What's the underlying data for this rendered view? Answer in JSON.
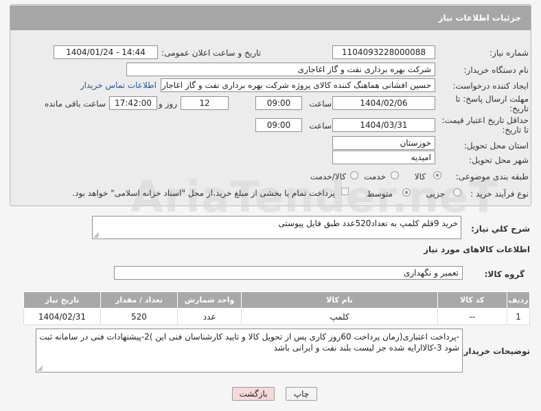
{
  "header": {
    "title": "جزئیات اطلاعات نیاز"
  },
  "fields": {
    "need_number_label": "شماره نیاز:",
    "need_number": "1104093228000088",
    "announce_label": "تاریخ و ساعت اعلان عمومی:",
    "announce_value": "1404/01/24 - 14:44",
    "buyer_org_label": "نام دستگاه خریدار:",
    "buyer_org": "شرکت بهره برداری نفت و گاز اغاجاری",
    "requester_label": "ایجاد کننده درخواست:",
    "requester": "حسین افشانی هماهنگ کننده کالای پروژه شرکت بهره برداری نفت و گاز اغاجاری",
    "contact_link": "اطلاعات تماس خریدار",
    "deadline_label_1": "مهلت ارسال پاسخ: تا",
    "deadline_label_2": "تاریخ:",
    "deadline_date": "1404/02/06",
    "time_label": "ساعت",
    "deadline_time": "09:00",
    "days_value": "12",
    "days_label": "روز و",
    "remaining_time": "17:42:00",
    "remaining_label": "ساعت باقی مانده",
    "validity_label_1": "حداقل تاریخ اعتبار قیمت:",
    "validity_label_2": "تا تاریخ:",
    "validity_date": "1404/03/31",
    "validity_time": "09:00",
    "province_label": "استان محل تحویل:",
    "province": "خوزستان",
    "city_label": "شهر محل تحویل:",
    "city": "امیدیه",
    "category_label": "طبقه بندی موضوعی:",
    "category_options": [
      "کالا",
      "خدمت",
      "کالا/خدمت"
    ],
    "purchase_type_label": "نوع فرآیند خرید :",
    "purchase_options": [
      "جزیی",
      "متوسط"
    ],
    "treasury_note": "پرداخت تمام یا بخشی از مبلغ خرید،از محل \"اسناد خزانه اسلامی\" خواهد بود."
  },
  "description": {
    "label": "شرح کلي نياز:",
    "value": "خرید 9قلم کلمپ به تعداد520عدد طبق فایل پیوستی"
  },
  "goods_info_title": "اطلاعات کالاهای مورد نیاز",
  "goods_group": {
    "label": "گروه کالا:",
    "value": "تعمیر و نگهداری"
  },
  "table": {
    "headers": [
      "ردیف",
      "کد کالا",
      "نام کالا",
      "واحد شمارش",
      "تعداد / مقدار",
      "تاریخ نیاز"
    ],
    "rows": [
      [
        "1",
        "--",
        "کلمپ",
        "عدد",
        "520",
        "1404/02/31"
      ]
    ]
  },
  "buyer_notes": {
    "label": "توضیحات خریدار:",
    "value": "-پرداخت اعتباری(زمان پرداخت 60روز کاری پس از تحویل کالا و تایید کارشناسان فنی این )2-پیشنهادات فنی در سامانه ثبت شود 3-کالاارایه شده جز لیست بلند نفت و ایرانی باشد"
  },
  "buttons": {
    "print": "چاپ",
    "back": "بازگشت"
  },
  "watermark": "AriaTender.neT",
  "colors": {
    "header_bg": "#a6a6a6",
    "link": "#1a5aa6",
    "back_button": "#f7d9d9"
  }
}
